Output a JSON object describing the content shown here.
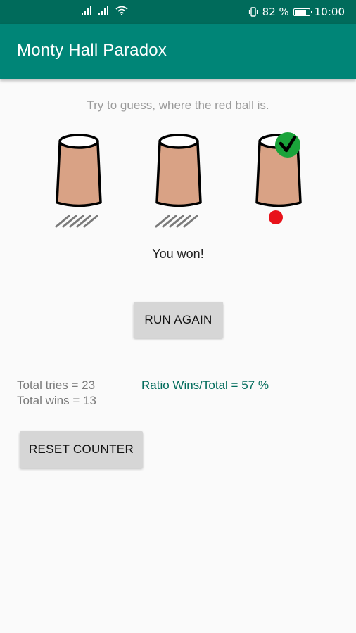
{
  "status_bar": {
    "battery_percent": "82 %",
    "time": "10:00",
    "battery_level": 0.82,
    "icons": [
      "signal-icon",
      "signal-icon",
      "wifi-icon",
      "vibrate-icon",
      "battery-icon"
    ]
  },
  "app": {
    "title": "Monty Hall Paradox",
    "primary_color": "#008577",
    "primary_dark_color": "#006b5b"
  },
  "game": {
    "hint": "Try to guess, where the red ball is.",
    "result": "You won!",
    "cups": [
      {
        "state": "empty",
        "selected": false
      },
      {
        "state": "empty",
        "selected": false
      },
      {
        "state": "ball",
        "selected": true
      }
    ]
  },
  "buttons": {
    "run_again": "RUN AGAIN",
    "reset_counter": "RESET COUNTER"
  },
  "stats": {
    "total_tries": "Total tries = 23",
    "total_wins": "Total wins = 13",
    "ratio": "Ratio Wins/Total = 57 %"
  }
}
